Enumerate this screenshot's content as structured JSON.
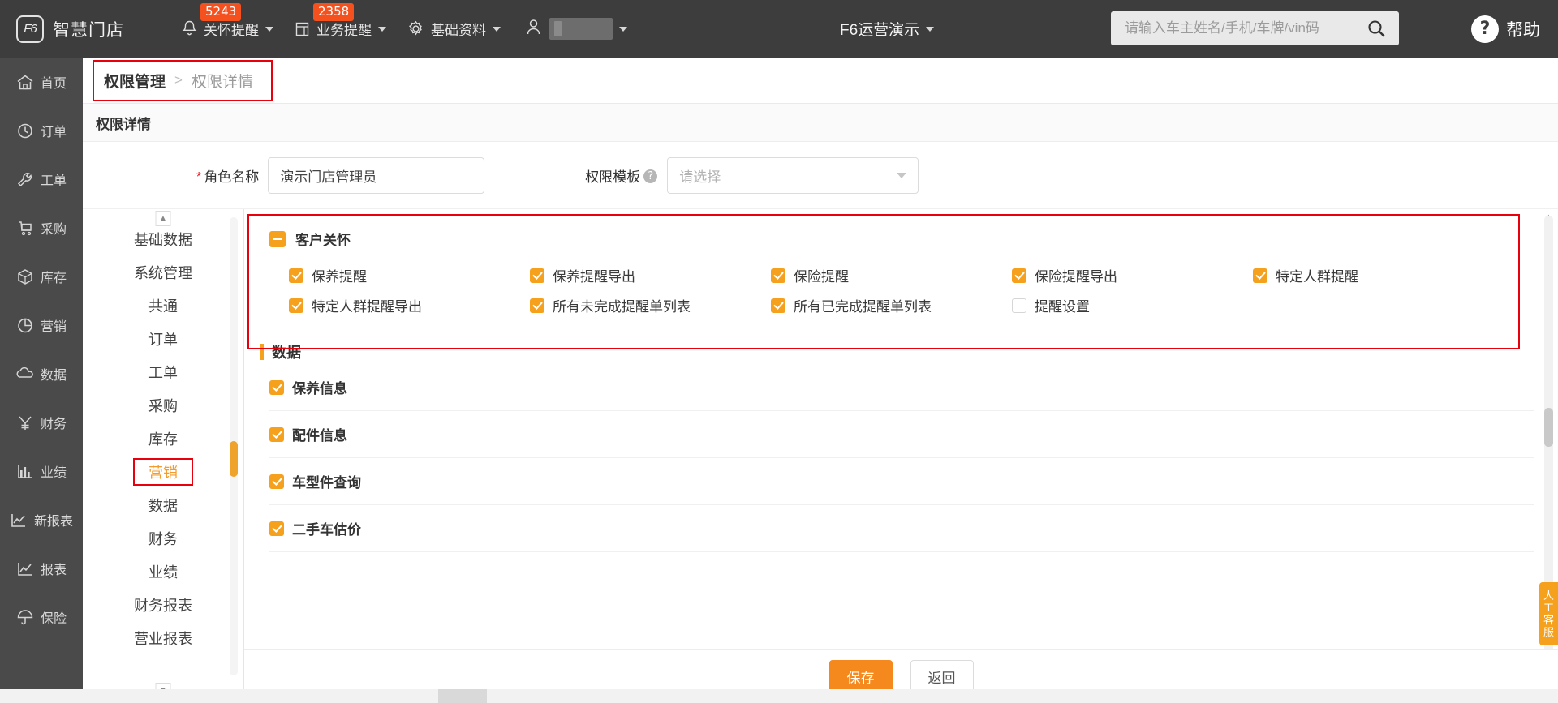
{
  "topbar": {
    "logo_text": "F6",
    "brand": "智慧门店",
    "nav": [
      {
        "label": "关怀提醒",
        "badge": "5243",
        "icon": "bell-icon"
      },
      {
        "label": "业务提醒",
        "badge": "2358",
        "icon": "clipboard-icon"
      },
      {
        "label": "基础资料",
        "badge": "",
        "icon": "gear-icon"
      }
    ],
    "user_name": "",
    "shop_selector": "F6运营演示",
    "search_placeholder": "请输入车主姓名/手机/车牌/vin码",
    "help_label": "帮助"
  },
  "rail": {
    "items": [
      {
        "label": "首页",
        "icon": "home-icon"
      },
      {
        "label": "订单",
        "icon": "clock-icon"
      },
      {
        "label": "工单",
        "icon": "wrench-icon"
      },
      {
        "label": "采购",
        "icon": "cart-icon"
      },
      {
        "label": "库存",
        "icon": "box-icon"
      },
      {
        "label": "营销",
        "icon": "pie-icon"
      },
      {
        "label": "数据",
        "icon": "cloud-icon"
      },
      {
        "label": "财务",
        "icon": "yuan-icon"
      },
      {
        "label": "业绩",
        "icon": "bar-chart-icon"
      },
      {
        "label": "新报表",
        "icon": "line-chart-icon"
      },
      {
        "label": "报表",
        "icon": "line-chart-icon"
      },
      {
        "label": "保险",
        "icon": "umbrella-icon"
      }
    ]
  },
  "breadcrumb": {
    "current": "权限管理",
    "separator": ">",
    "next": "权限详情"
  },
  "page": {
    "title": "权限详情"
  },
  "form": {
    "role_label": "角色名称",
    "role_value": "演示门店管理员",
    "template_label": "权限模板",
    "template_placeholder": "请选择"
  },
  "menu": {
    "items": [
      {
        "label": "基础数据",
        "active": false
      },
      {
        "label": "系统管理",
        "active": false
      },
      {
        "label": "共通",
        "active": false
      },
      {
        "label": "订单",
        "active": false
      },
      {
        "label": "工单",
        "active": false
      },
      {
        "label": "采购",
        "active": false
      },
      {
        "label": "库存",
        "active": false
      },
      {
        "label": "营销",
        "active": true
      },
      {
        "label": "数据",
        "active": false
      },
      {
        "label": "财务",
        "active": false
      },
      {
        "label": "业绩",
        "active": false
      },
      {
        "label": "财务报表",
        "active": false
      },
      {
        "label": "营业报表",
        "active": false
      }
    ]
  },
  "permissions": {
    "group": {
      "title": "客户关怀",
      "toggle_icon": "minus-icon",
      "checkboxes": [
        {
          "label": "保养提醒",
          "checked": true
        },
        {
          "label": "保养提醒导出",
          "checked": true
        },
        {
          "label": "保险提醒",
          "checked": true
        },
        {
          "label": "保险提醒导出",
          "checked": true
        },
        {
          "label": "特定人群提醒",
          "checked": true
        },
        {
          "label": "特定人群提醒导出",
          "checked": true
        },
        {
          "label": "所有未完成提醒单列表",
          "checked": true
        },
        {
          "label": "所有已完成提醒单列表",
          "checked": true
        },
        {
          "label": "提醒设置",
          "checked": false
        }
      ]
    },
    "section": {
      "title": "数据",
      "rows": [
        {
          "label": "保养信息",
          "checked": true
        },
        {
          "label": "配件信息",
          "checked": true
        },
        {
          "label": "车型件查询",
          "checked": true
        },
        {
          "label": "二手车估价",
          "checked": true
        }
      ]
    }
  },
  "footer": {
    "save_label": "保存",
    "back_label": "返回"
  },
  "service_tab": {
    "label": "人工客服"
  },
  "colors": {
    "accent": "#f5a11d",
    "primary_button": "#f5891d",
    "highlight_box": "#e8000d",
    "topbar_bg": "#3d3d3d",
    "rail_bg": "#4a4a4a",
    "badge_bg": "#f4511e"
  }
}
